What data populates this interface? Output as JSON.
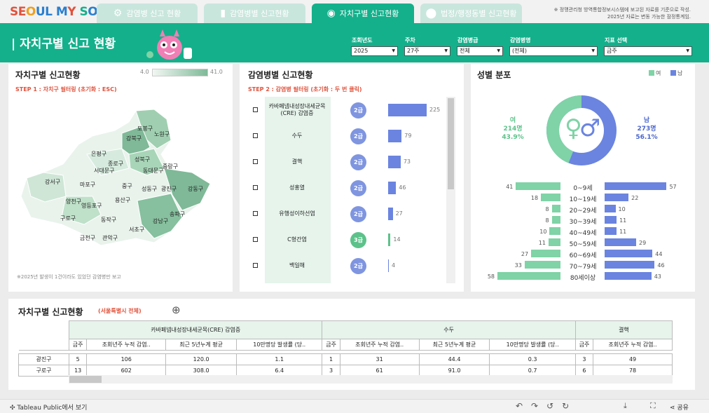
{
  "logo": {
    "part1": "SE",
    "part2": "UL M",
    "part3": "Y",
    "part4": " S",
    "part5": "UL"
  },
  "tabs": [
    {
      "label": "감염병 신고 현황",
      "icon": "gear-icon"
    },
    {
      "label": "감염병별 신고현황",
      "icon": "bar-chart-icon"
    },
    {
      "label": "자치구별 신고현황",
      "icon": "globe-icon"
    },
    {
      "label": "법정/행정동별 신고현황",
      "icon": "map-pin-icon"
    }
  ],
  "top_note": {
    "line1": "※ 정맹관리청 방역통합정보시스템에 보고된 자료를 기준으로 작성.",
    "line2": "2025년 자료는 변동 가능한 잠정통계임."
  },
  "header": {
    "title": "| 자치구별 신고 현황"
  },
  "filters": [
    {
      "label": "조회년도",
      "value": "2025"
    },
    {
      "label": "주차",
      "value": "27주"
    },
    {
      "label": "감염병급",
      "value": "전체"
    },
    {
      "label": "감염병명",
      "value": "(전체)"
    },
    {
      "label": "지표 선택",
      "value": "금주"
    }
  ],
  "map_panel": {
    "title": "자치구별 신고현황",
    "legend_min": "4.0",
    "legend_max": "41.0",
    "step": "STEP 1 : 자치구 필터링 (초기화 : ESC)",
    "note": "※2025년 발생이 1건이라도 있었던 감염병만 보고",
    "districts": [
      "도봉구",
      "노원구",
      "강북구",
      "은평구",
      "성북구",
      "종로구",
      "동대문구",
      "중랑구",
      "서대문구",
      "강서구",
      "마포구",
      "중구",
      "성동구",
      "광진구",
      "강동구",
      "용산구",
      "양천구",
      "영등포구",
      "구로구",
      "동작구",
      "송파구",
      "강남구",
      "서초구",
      "금천구",
      "관악구"
    ]
  },
  "disease_panel": {
    "title": "감염병별 신고현황",
    "step": "STEP 2 : 감염병 필터링 (초기화 : 두 번 클릭)",
    "items": [
      {
        "name": "카바페넴내성장내세균목(CRE) 감염증",
        "grade": "2급",
        "value": 225
      },
      {
        "name": "수두",
        "grade": "2급",
        "value": 79
      },
      {
        "name": "결핵",
        "grade": "2급",
        "value": 73
      },
      {
        "name": "성홍열",
        "grade": "2급",
        "value": 46
      },
      {
        "name": "유행성이하선염",
        "grade": "2급",
        "value": 27
      },
      {
        "name": "C형간염",
        "grade": "3급",
        "value": 14
      },
      {
        "name": "백일해",
        "grade": "2급",
        "value": 4
      }
    ]
  },
  "gender_panel": {
    "title": "성별 분포",
    "legend_f": "여",
    "legend_m": "남",
    "female": {
      "label": "여",
      "count": "214명",
      "pct": "43.9%",
      "fraction": 0.439
    },
    "male": {
      "label": "남",
      "count": "273명",
      "pct": "56.1%"
    },
    "ages": [
      {
        "label": "0~9세",
        "f": 41,
        "m": 57
      },
      {
        "label": "10~19세",
        "f": 18,
        "m": 22
      },
      {
        "label": "20~29세",
        "f": 8,
        "m": 10
      },
      {
        "label": "30~39세",
        "f": 8,
        "m": 11
      },
      {
        "label": "40~49세",
        "f": 10,
        "m": 11
      },
      {
        "label": "50~59세",
        "f": 11,
        "m": 29
      },
      {
        "label": "60~69세",
        "f": 27,
        "m": 44
      },
      {
        "label": "70~79세",
        "f": 33,
        "m": 46
      },
      {
        "label": "80세이상",
        "f": 58,
        "m": 43
      }
    ]
  },
  "colors": {
    "female": "#7fd3a6",
    "male": "#6a84e0",
    "accent": "#14b08b"
  },
  "table_panel": {
    "title": "자치구별 신고현황",
    "subtitle": "(서울특별시 전체)",
    "groups": [
      "카바페넴내성장내세균목(CRE) 감염증",
      "수두",
      "결핵"
    ],
    "cols": [
      "금주",
      "조회년주 누적 감염..",
      "최근 5년누계 평균",
      "10만명당 발생률 (당.."
    ],
    "rows": [
      {
        "name": "광진구",
        "vals": [
          "5",
          "106",
          "120.0",
          "1.1",
          "1",
          "31",
          "44.4",
          "0.3",
          "3",
          "49"
        ]
      },
      {
        "name": "구로구",
        "vals": [
          "13",
          "602",
          "308.0",
          "6.4",
          "3",
          "61",
          "91.0",
          "0.7",
          "6",
          "78"
        ]
      }
    ]
  },
  "footer": {
    "tableau": "Tableau Public에서 보기",
    "share": "공유"
  }
}
